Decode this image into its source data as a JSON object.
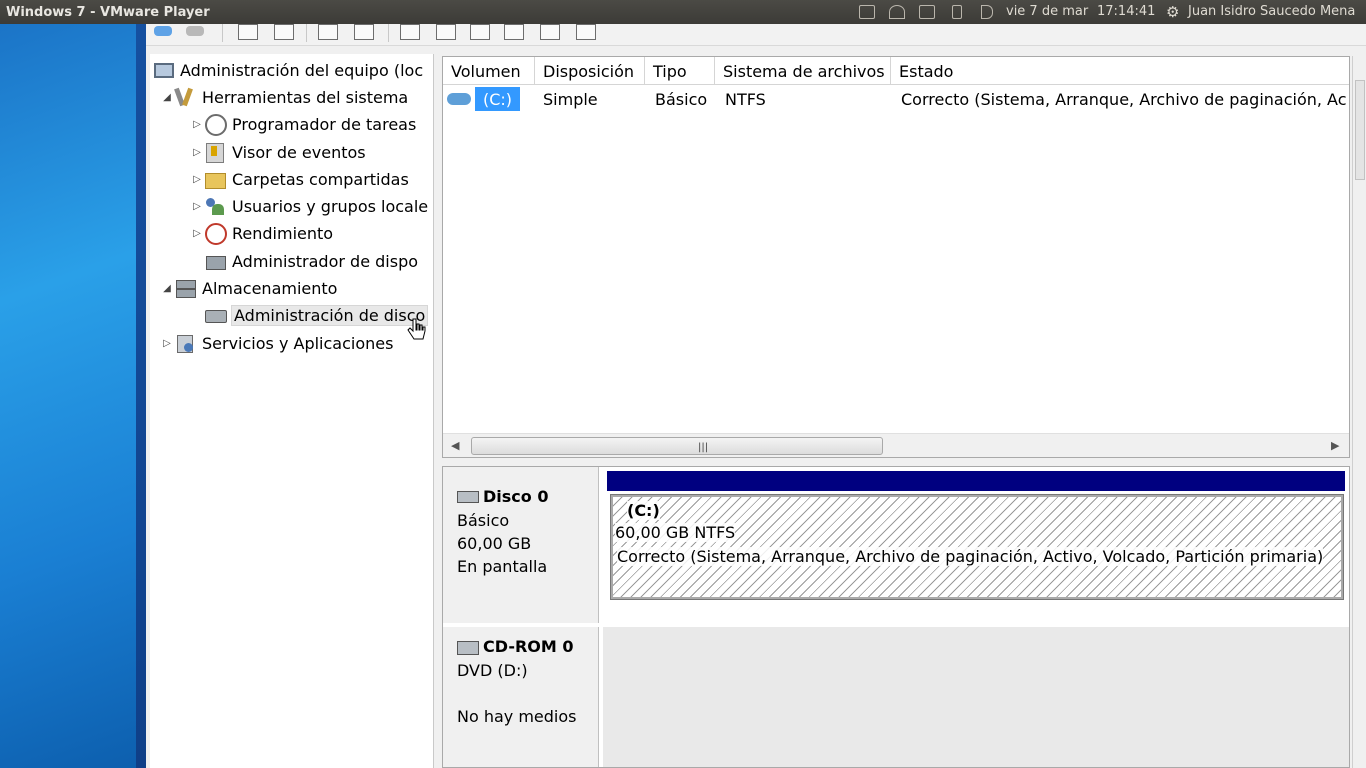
{
  "topbar": {
    "title": "Windows 7 - VMware Player",
    "date": "vie 7 de mar",
    "time": "17:14:41",
    "user": "Juan Isidro Saucedo Mena",
    "indicator_icons": [
      "keyboard-icon",
      "wifi-icon",
      "mail-icon",
      "battery-icon",
      "volume-icon"
    ]
  },
  "tree": {
    "root": "Administración del equipo (loc",
    "system_tools": "Herramientas del sistema",
    "task_scheduler": "Programador de tareas",
    "event_viewer": "Visor de eventos",
    "shared_folders": "Carpetas compartidas",
    "local_users": "Usuarios y grupos locale",
    "performance": "Rendimiento",
    "device_manager": "Administrador de dispo",
    "storage": "Almacenamiento",
    "disk_management": "Administración de disco",
    "services_apps": "Servicios y Aplicaciones"
  },
  "volume_list": {
    "columns": [
      "Volumen",
      "Disposición",
      "Tipo",
      "Sistema de archivos",
      "Estado"
    ],
    "rows": [
      {
        "volume": "(C:)",
        "layout": "Simple",
        "type": "Básico",
        "fs": "NTFS",
        "status": "Correcto (Sistema, Arranque, Archivo de paginación, Ac"
      }
    ]
  },
  "disks": [
    {
      "name": "Disco 0",
      "type": "Básico",
      "size": "60,00 GB",
      "state": "En pantalla",
      "partition": {
        "label": "(C:)",
        "size_fs": "60,00 GB NTFS",
        "status": "Correcto (Sistema, Arranque, Archivo de paginación, Activo, Volcado, Partición primaria)"
      }
    },
    {
      "name": "CD-ROM 0",
      "type": "DVD (D:)",
      "state": "No hay medios"
    }
  ],
  "colors": {
    "selection": "#3399ff",
    "partition_bar": "#000080",
    "desktop_blue": "#1b74c7"
  }
}
